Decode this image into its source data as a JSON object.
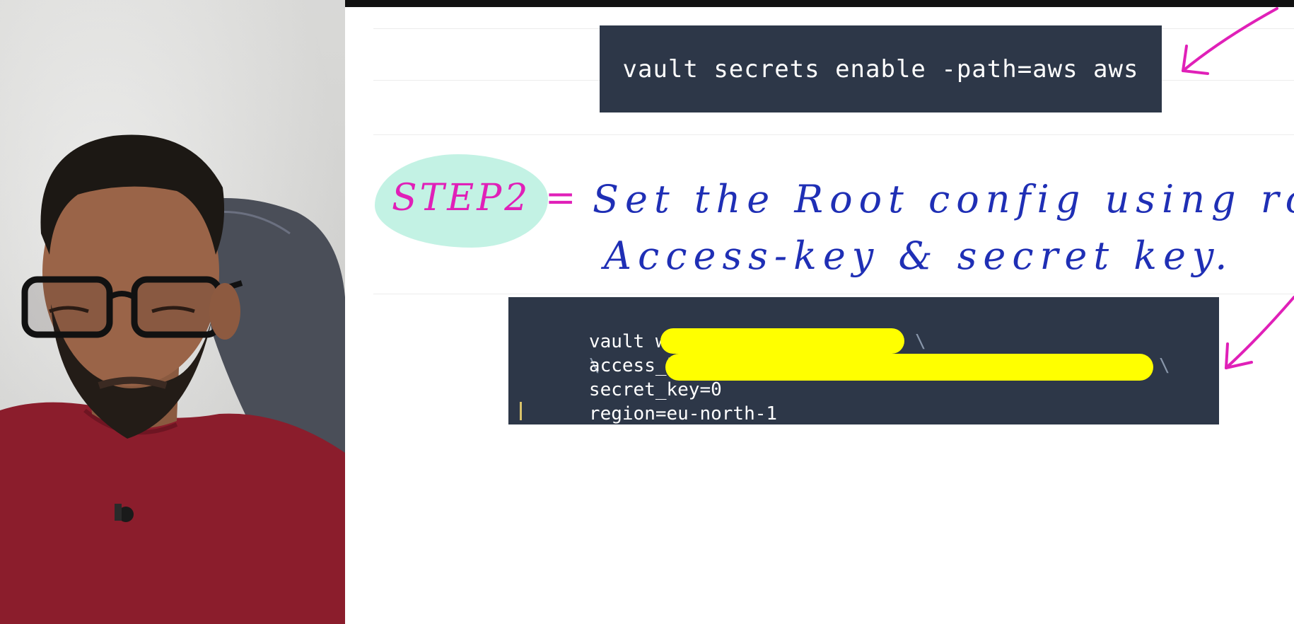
{
  "whiteboard": {
    "command1": "vault secrets enable -path=aws aws",
    "step": {
      "label": "STEP2 =",
      "line1": "Set the Root config using root",
      "line2": "Access-key & secret key."
    },
    "command2": {
      "line1": "vault write aws/config/root",
      "line1_continuation": "\\",
      "line2_key": "access_key=",
      "line2_continuation": "\\",
      "line3_key": "secret_key=0",
      "line3_continuation": "\\",
      "line4": "region=eu-north-1"
    }
  },
  "colors": {
    "code_background": "#2d3748",
    "code_text": "#ffffff",
    "step_label": "#e020b8",
    "step_text": "#1f2fb5",
    "highlight": "#b8f0df",
    "redaction": "#ffff00",
    "arrow": "#e020b8"
  }
}
